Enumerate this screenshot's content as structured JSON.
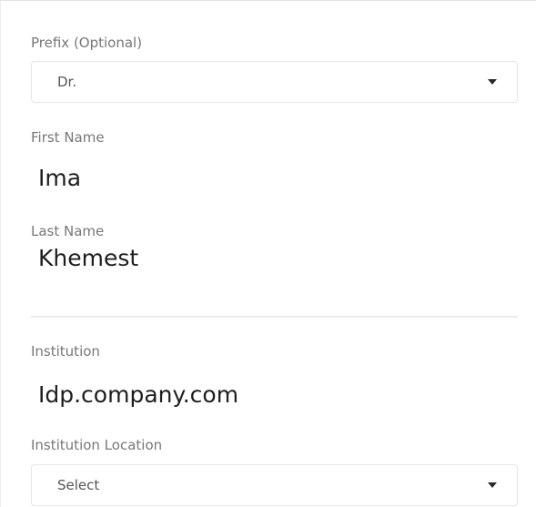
{
  "prefix": {
    "label": "Prefix (Optional)",
    "selected": "Dr."
  },
  "first_name": {
    "label": "First Name",
    "value": "Ima"
  },
  "last_name": {
    "label": "Last Name",
    "value": "Khemest"
  },
  "institution": {
    "label": "Institution",
    "value": "Idp.company.com"
  },
  "institution_location": {
    "label": "Institution Location",
    "selected": "Select"
  },
  "icons": {
    "dropdown": "caret-down-icon"
  }
}
